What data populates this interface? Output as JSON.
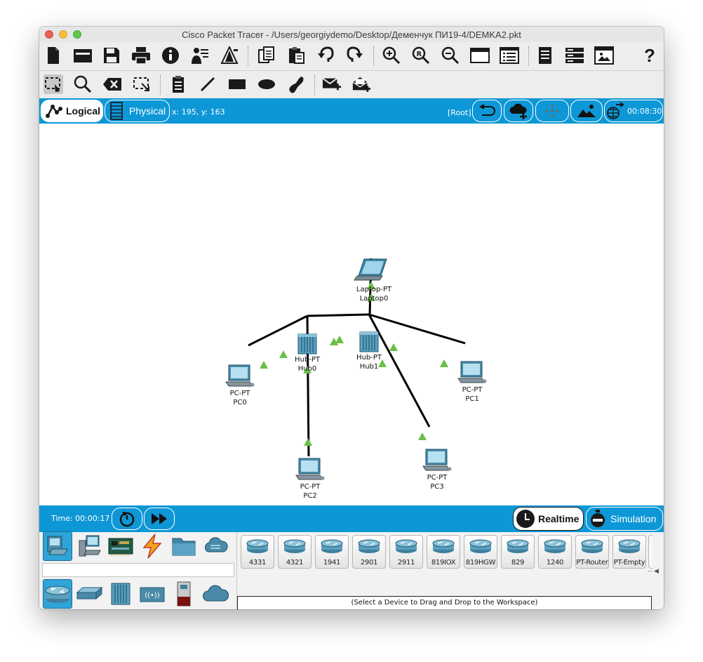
{
  "window": {
    "title": "Cisco Packet Tracer - /Users/georgiydemo/Desktop/Деменчук ПИ19-4/DEMKA2.pkt"
  },
  "toolbar_main": {
    "icons": [
      "new-file-icon",
      "open-folder-icon",
      "save-icon",
      "print-icon",
      "info-icon",
      "activity-wizard-icon",
      "custom-pdu-icon",
      "copy-icon",
      "paste-icon",
      "undo-icon",
      "redo-icon",
      "zoom-in-icon",
      "zoom-reset-icon",
      "zoom-out-icon",
      "drawing-palette-icon",
      "custom-device-dialog-icon",
      "notes-icon",
      "device-template-icon",
      "viewport-icon",
      "help-icon"
    ],
    "help_glyph": "?"
  },
  "toolbar_tools": {
    "icons": [
      "select-icon",
      "inspect-icon",
      "delete-icon",
      "resize-shape-icon",
      "place-note-icon",
      "draw-line-icon",
      "draw-rectangle-icon",
      "draw-ellipse-icon",
      "draw-freeform-icon",
      "add-simple-pdu-icon",
      "add-complex-pdu-icon"
    ]
  },
  "mode_bar": {
    "logical_label": "Logical",
    "physical_label": "Physical",
    "coords": "x: 195, y: 163",
    "root_label": "[Root]",
    "clock": "00:08:30"
  },
  "topology": {
    "devices": [
      {
        "id": "laptop0",
        "type": "laptop",
        "model": "Laptop-PT",
        "name": "Laptop0"
      },
      {
        "id": "hub0",
        "type": "hub",
        "model": "Hub-PT",
        "name": "Hub0"
      },
      {
        "id": "hub1",
        "type": "hub",
        "model": "Hub-PT",
        "name": "Hub1"
      },
      {
        "id": "pc0",
        "type": "pc",
        "model": "PC-PT",
        "name": "PC0"
      },
      {
        "id": "pc1",
        "type": "pc",
        "model": "PC-PT",
        "name": "PC1"
      },
      {
        "id": "pc2",
        "type": "pc",
        "model": "PC-PT",
        "name": "PC2"
      },
      {
        "id": "pc3",
        "type": "pc",
        "model": "PC-PT",
        "name": "PC3"
      }
    ],
    "links": [
      {
        "from": "hub1",
        "to": "laptop0"
      },
      {
        "from": "hub0",
        "to": "hub1"
      },
      {
        "from": "hub0",
        "to": "pc0"
      },
      {
        "from": "hub0",
        "to": "pc2"
      },
      {
        "from": "hub1",
        "to": "pc1"
      },
      {
        "from": "hub1",
        "to": "pc3"
      }
    ],
    "link_color": "#000000",
    "link_status_color": "#6abf45"
  },
  "sim_bar": {
    "time_label": "Time: 00:00:17",
    "realtime_label": "Realtime",
    "simulation_label": "Simulation"
  },
  "device_panel": {
    "categories_top": [
      "network-devices-icon",
      "end-devices-icon",
      "components-icon",
      "connections-icon",
      "miscellaneous-icon",
      "multiuser-icon"
    ],
    "categories_bottom": [
      "routers-icon",
      "switches-icon",
      "hubs-icon",
      "wireless-devices-icon",
      "security-icon",
      "wan-emulation-icon"
    ],
    "search_value": "",
    "models": [
      "4331",
      "4321",
      "1941",
      "2901",
      "2911",
      "819IOX",
      "819HGW",
      "829",
      "1240",
      "PT-Router",
      "PT-Empty"
    ],
    "hint": "(Select a Device to Drag and Drop to the Workspace)"
  },
  "colors": {
    "accent_blue": "#0d97d6",
    "router_blue": "#5b9fbd"
  }
}
